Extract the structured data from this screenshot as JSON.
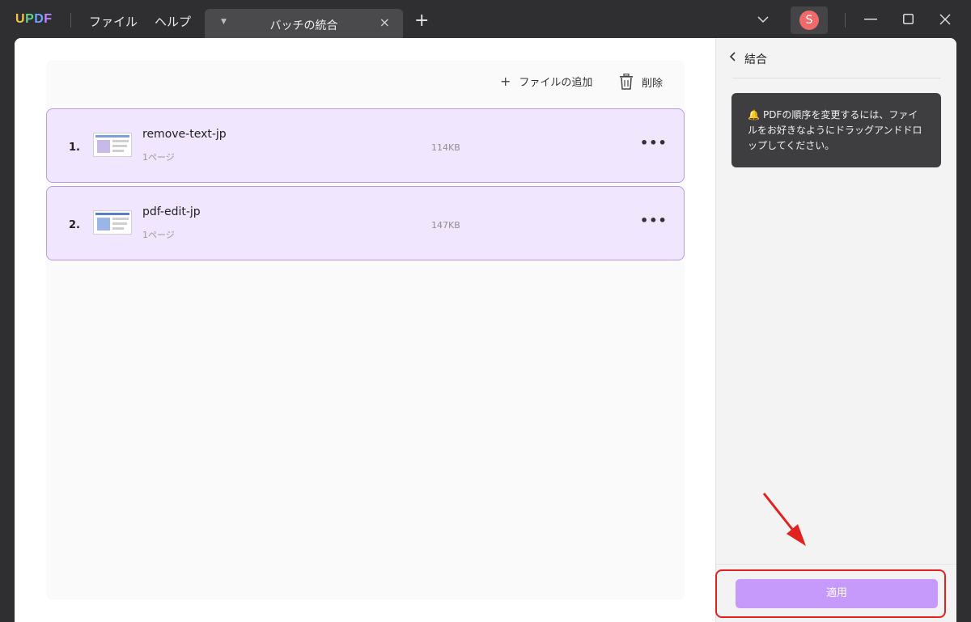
{
  "app": {
    "logo": [
      "U",
      "P",
      "D",
      "F"
    ]
  },
  "menu": {
    "file": "ファイル",
    "help": "ヘルプ"
  },
  "tab": {
    "title": "バッチの統合",
    "close": "×"
  },
  "toolbar": {
    "add_file": "ファイルの追加",
    "delete": "削除"
  },
  "files": [
    {
      "index": "1.",
      "name": "remove-text-jp",
      "pages": "1ページ",
      "size": "114KB"
    },
    {
      "index": "2.",
      "name": "pdf-edit-jp",
      "pages": "1ページ",
      "size": "147KB"
    }
  ],
  "side": {
    "title": "結合",
    "tip": "PDFの順序を変更するには、ファイルをお好きなようにドラッグアンドドロップしてください。",
    "apply": "適用"
  },
  "user": {
    "avatar_letter": "S"
  },
  "colors": {
    "accent": "#c69afa",
    "row_bg": "#f0e6fd",
    "row_border": "#b89ae6",
    "highlight": "#e2221f"
  }
}
